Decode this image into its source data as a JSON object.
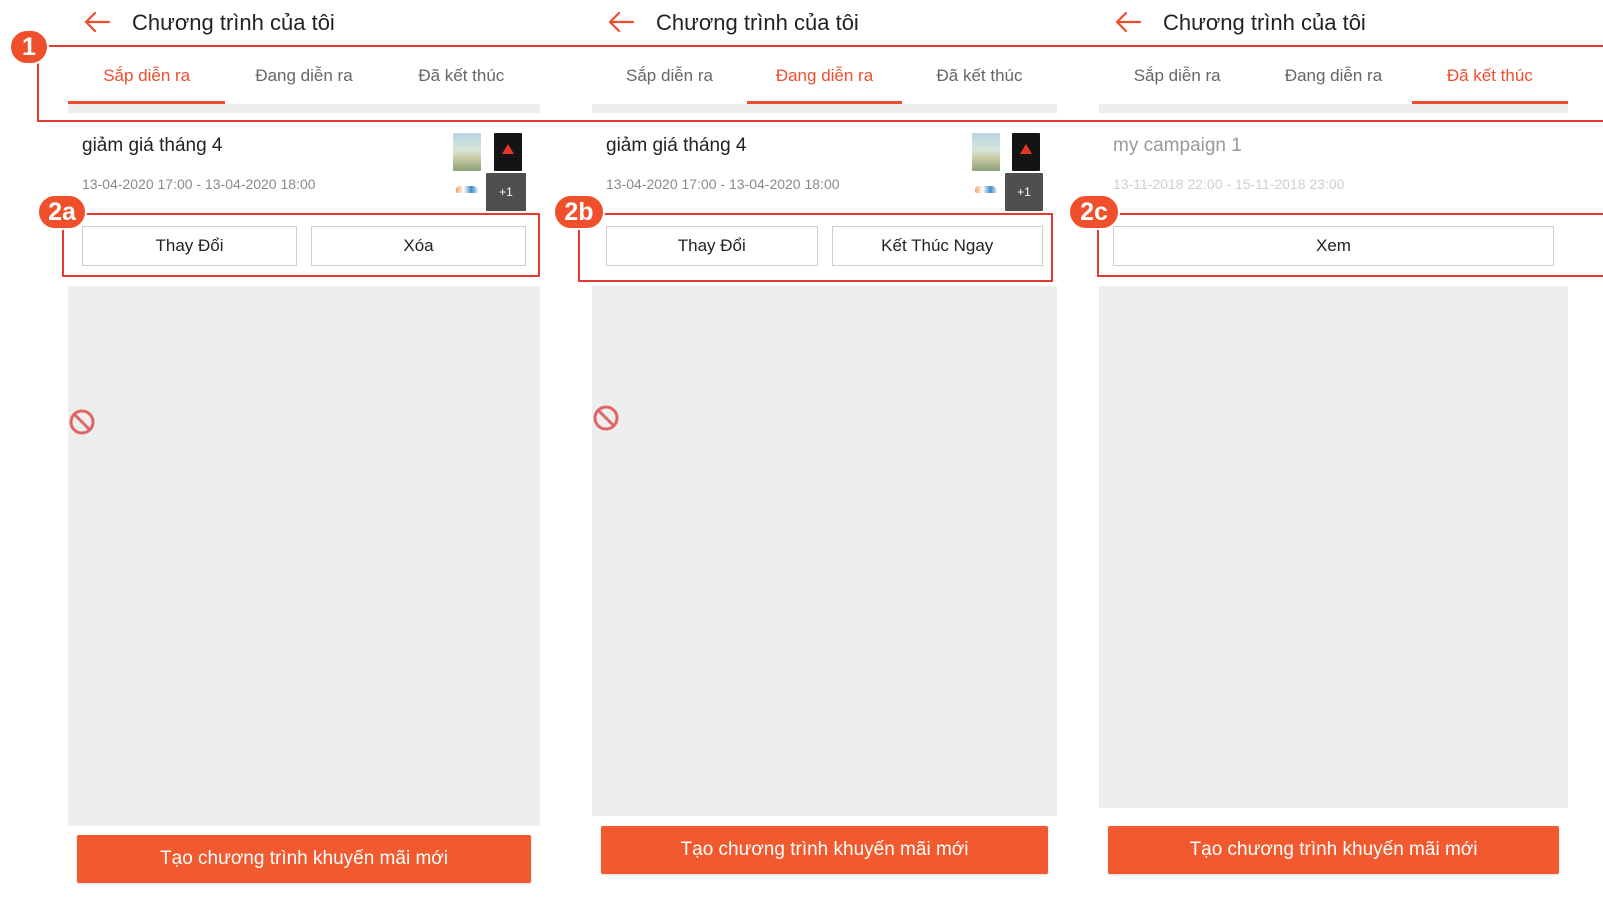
{
  "screens": [
    {
      "title": "Chương trình của tôi",
      "tabs": [
        "Sắp diễn ra",
        "Đang diễn ra",
        "Đã kết thúc"
      ],
      "active_tab": 0,
      "campaign": {
        "name": "giảm giá tháng 4",
        "date_range": "13-04-2020 17:00 - 13-04-2020 18:00",
        "more_products": "+1"
      },
      "buttons": [
        "Thay Đổi",
        "Xóa"
      ],
      "cta": "Tạo chương trình khuyến mãi mới"
    },
    {
      "title": "Chương trình của tôi",
      "tabs": [
        "Sắp diễn ra",
        "Đang diễn ra",
        "Đã kết thúc"
      ],
      "active_tab": 1,
      "campaign": {
        "name": "giảm giá tháng 4",
        "date_range": "13-04-2020 17:00 - 13-04-2020 18:00",
        "more_products": "+1"
      },
      "buttons": [
        "Thay Đổi",
        "Kết Thúc Ngay"
      ],
      "cta": "Tạo chương trình khuyến mãi mới"
    },
    {
      "title": "Chương trình của tôi",
      "tabs": [
        "Sắp diễn ra",
        "Đang diễn ra",
        "Đã kết thúc"
      ],
      "active_tab": 2,
      "campaign": {
        "name": "my campaign 1",
        "date_range": "13-11-2018 22:00 - 15-11-2018 23:00"
      },
      "buttons": [
        "Xem"
      ],
      "cta": "Tạo chương trình khuyến mãi mới"
    }
  ],
  "annotations": {
    "tabs_label": "1",
    "screen_labels": [
      "2a",
      "2b",
      "2c"
    ]
  },
  "colors": {
    "accent": "#ee4d2d",
    "cta_bg": "#f05a2e",
    "annotation": "#e53935",
    "list_bg": "#eeeeee"
  },
  "icons": {
    "back": "arrow-left-icon",
    "empty": "no-entry-icon"
  }
}
